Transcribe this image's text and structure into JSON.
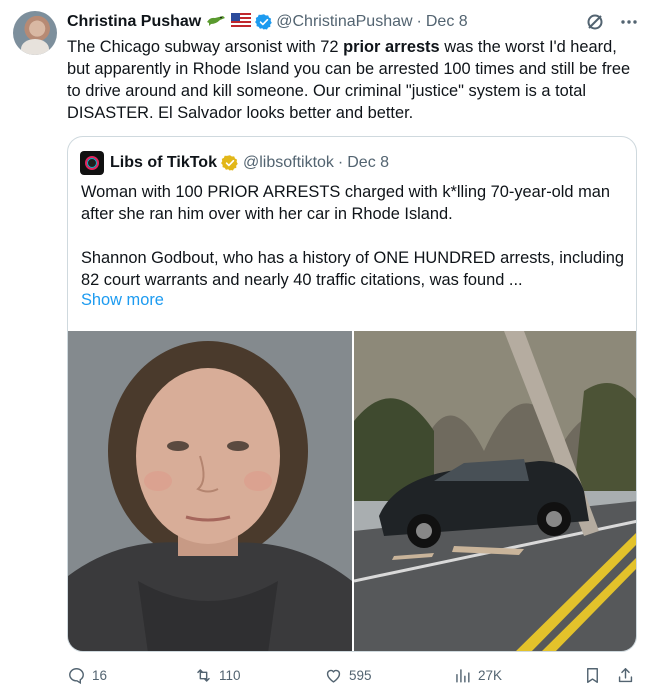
{
  "author": {
    "name": "Christina Pushaw",
    "handle": "@ChristinaPushaw",
    "separator": "·",
    "date": "Dec 8",
    "name_emoji_icons": [
      "alligator-emoji-icon",
      "us-flag-emoji-icon"
    ],
    "verified_color": "#1d9bf0"
  },
  "tweet": {
    "text_part1": "The Chicago subway arsonist with 72 ",
    "text_bold": "prior arrests",
    "text_part2": " was the worst I'd heard, but apparently in Rhode Island you can be arrested 100 times and still be free to drive around and kill someone. Our criminal \"justice\" system is a total DISASTER. El Salvador looks better and better."
  },
  "quote": {
    "name": "Libs of TikTok",
    "handle": "@libsoftiktok",
    "separator": "·",
    "date": "Dec 8",
    "badge_color": "#e2b719",
    "paragraph1": "Woman with 100 PRIOR ARRESTS charged with k*lling 70-year-old man after she ran him over with her car in Rhode Island.",
    "paragraph2": "Shannon Godbout, who has a history of ONE HUNDRED arrests, including 82 court warrants and nearly 40 traffic citations, was found ...",
    "show_more": "Show more",
    "media": [
      "mugshot-photo",
      "crash-scene-photo"
    ]
  },
  "actions": {
    "replies": "16",
    "reposts": "110",
    "likes": "595",
    "views": "27K"
  },
  "colors": {
    "text": "#0f1419",
    "secondary": "#536471",
    "link": "#1d9bf0",
    "border": "#cfd9de"
  }
}
